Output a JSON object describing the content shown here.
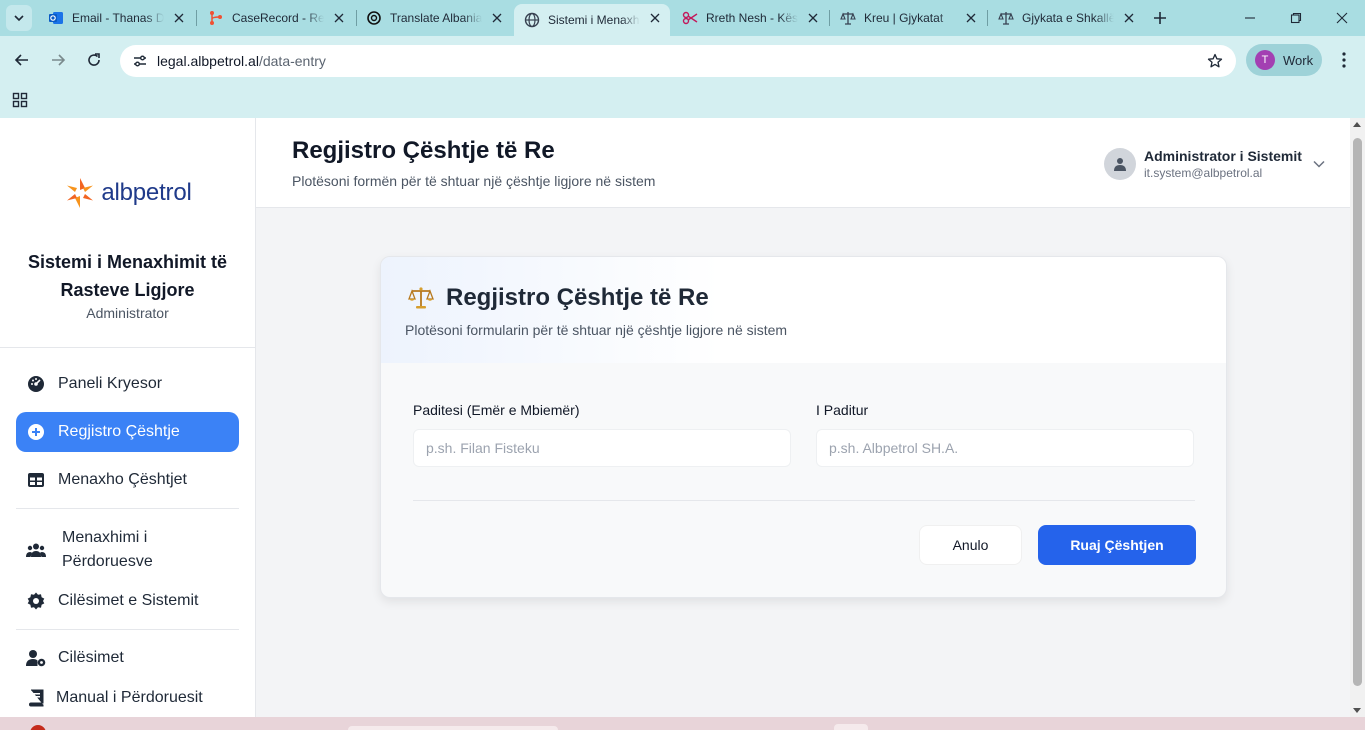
{
  "browser": {
    "tabs": [
      {
        "title": "Email - Thanas D",
        "icon": "outlook-icon",
        "active": false
      },
      {
        "title": "CaseRecord - Re",
        "icon": "git-icon",
        "active": false
      },
      {
        "title": "Translate Albania",
        "icon": "openai-icon",
        "active": false
      },
      {
        "title": "Sistemi i Menaxh",
        "icon": "globe-icon",
        "active": true
      },
      {
        "title": "Rreth Nesh - Kës",
        "icon": "scissors-icon",
        "active": false
      },
      {
        "title": "Kreu | Gjykatat",
        "icon": "scales-icon",
        "active": false
      },
      {
        "title": "Gjykata e Shkallë",
        "icon": "scales-icon",
        "active": false
      }
    ],
    "url_host": "legal.albpetrol.al",
    "url_path": "/data-entry",
    "profile_initial": "T",
    "profile_name": "Work",
    "accent": "#a9dde2"
  },
  "sidebar": {
    "brand_name": "albpetrol",
    "system_title": "Sistemi i Menaxhimit të Rasteve Ligjore",
    "role": "Administrator",
    "items": [
      {
        "label": "Paneli Kryesor",
        "icon": "dashboard-gauge-icon",
        "active": false
      },
      {
        "label": "Regjistro Çështje",
        "icon": "plus-circle-icon",
        "active": true
      },
      {
        "label": "Menaxho Çështjet",
        "icon": "table-icon",
        "active": false
      },
      {
        "label": "Menaxhimi i Përdoruesve",
        "icon": "users-icon",
        "active": false
      },
      {
        "label": "Cilësimet e Sistemit",
        "icon": "gear-icon",
        "active": false
      },
      {
        "label": "Cilësimet",
        "icon": "user-gear-icon",
        "active": false
      },
      {
        "label": "Manual i Përdoruesit",
        "icon": "book-icon",
        "active": false
      }
    ]
  },
  "header": {
    "title": "Regjistro Çështje të Re",
    "subtitle": "Plotësoni formën për të shtuar një çështje ligjore në sistem",
    "user_name": "Administrator i Sistemit",
    "user_email": "it.system@albpetrol.al"
  },
  "form": {
    "title": "Regjistro Çështje të Re",
    "subtitle": "Plotësoni formularin për të shtuar një çështje ligjore në sistem",
    "plaintiff_label": "Paditesi (Emër e Mbiemër)",
    "plaintiff_placeholder": "p.sh. Filan Fisteku",
    "plaintiff_value": "",
    "defendant_label": "I Paditur",
    "defendant_placeholder": "p.sh. Albpetrol SH.A.",
    "defendant_value": "",
    "cancel_label": "Anulo",
    "save_label": "Ruaj Çështjen",
    "primary_color": "#2563eb"
  }
}
